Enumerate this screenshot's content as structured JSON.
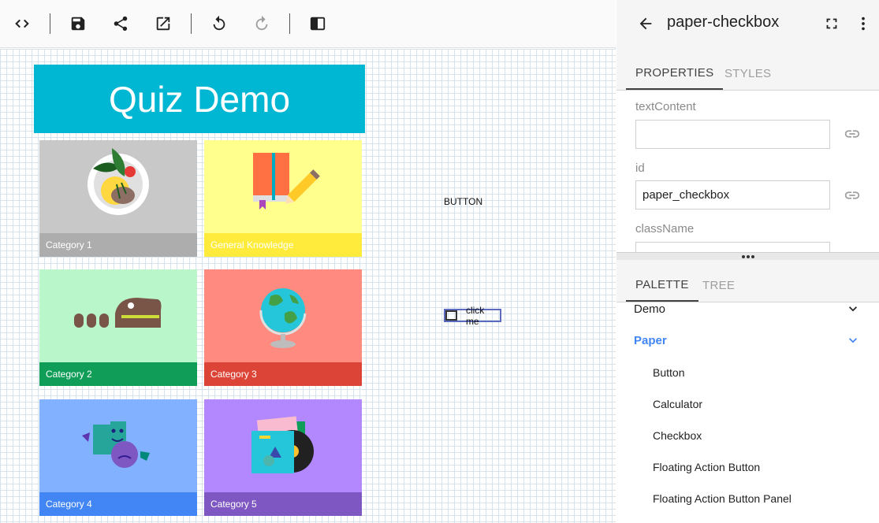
{
  "toolbar": {
    "buttons": [
      {
        "name": "code-toggle-button",
        "icon": "code-icon"
      },
      {
        "name": "save-button",
        "icon": "save-icon"
      },
      {
        "name": "share-button",
        "icon": "share-icon"
      },
      {
        "name": "open-external-button",
        "icon": "open-in-new-icon"
      },
      {
        "name": "undo-button",
        "icon": "undo-icon"
      },
      {
        "name": "redo-button",
        "icon": "redo-icon"
      },
      {
        "name": "toggle-panel-button",
        "icon": "side-panel-icon"
      }
    ]
  },
  "canvas": {
    "header_title": "Quiz Demo",
    "tiles": [
      {
        "caption": "Category 1",
        "bg": "#c8c8c8",
        "cap_bg": "#adadad",
        "icon": "salad-plate-icon"
      },
      {
        "caption": "General Knowledge",
        "bg": "#ffff8d",
        "cap_bg": "#ffeb3b",
        "icon": "book-pencil-icon"
      },
      {
        "caption": "Category 2",
        "bg": "#b9f6ca",
        "cap_bg": "#0f9d58",
        "icon": "dinosaur-skull-icon"
      },
      {
        "caption": "Category 3",
        "bg": "#ff8a80",
        "cap_bg": "#db4437",
        "icon": "globe-icon"
      },
      {
        "caption": "Category 4",
        "bg": "#82b1ff",
        "cap_bg": "#4285f4",
        "icon": "theater-masks-icon"
      },
      {
        "caption": "Category 5",
        "bg": "#b388ff",
        "cap_bg": "#7e57c2",
        "icon": "music-records-icon"
      }
    ],
    "button_label": "BUTTON",
    "checkbox_label": "click me"
  },
  "inspector": {
    "title": "paper-checkbox",
    "tabs": [
      "PROPERTIES",
      "STYLES"
    ],
    "active_tab": "PROPERTIES",
    "properties": [
      {
        "label": "textContent",
        "value": ""
      },
      {
        "label": "id",
        "value": "paper_checkbox"
      },
      {
        "label": "className",
        "value": ""
      }
    ]
  },
  "palette": {
    "tabs": [
      "PALETTE",
      "TREE"
    ],
    "active_tab": "PALETTE",
    "groups": [
      {
        "label": "Demo",
        "expanded": false
      },
      {
        "label": "Paper",
        "expanded": true
      }
    ],
    "items": [
      "Button",
      "Calculator",
      "Checkbox",
      "Floating Action Button",
      "Floating Action Button Panel"
    ],
    "accent": "#4285f4"
  }
}
